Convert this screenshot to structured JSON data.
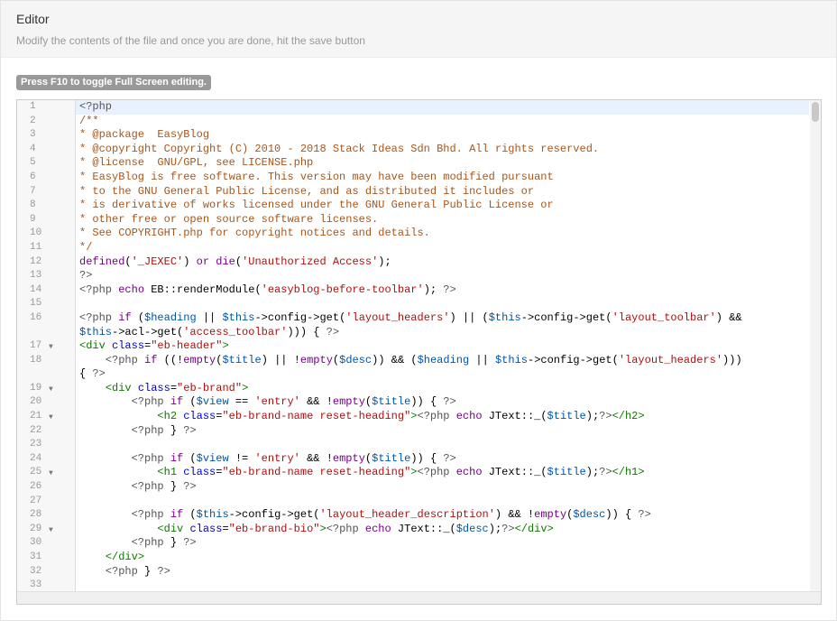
{
  "panel": {
    "title": "Editor",
    "description": "Modify the contents of the file and once you are done, hit the save button"
  },
  "badge": {
    "label": "Press F10 to toggle Full Screen editing."
  },
  "editor": {
    "active_line": 1,
    "lines": [
      {
        "n": "1",
        "fold": false,
        "tokens": [
          [
            "meta",
            "<?php"
          ]
        ]
      },
      {
        "n": "2",
        "fold": false,
        "tokens": [
          [
            "comment",
            "/**"
          ]
        ]
      },
      {
        "n": "3",
        "fold": false,
        "tokens": [
          [
            "comment",
            "* @package  EasyBlog"
          ]
        ]
      },
      {
        "n": "4",
        "fold": false,
        "tokens": [
          [
            "comment",
            "* @copyright Copyright (C) 2010 - 2018 Stack Ideas Sdn Bhd. All rights reserved."
          ]
        ]
      },
      {
        "n": "5",
        "fold": false,
        "tokens": [
          [
            "comment",
            "* @license  GNU/GPL, see LICENSE.php"
          ]
        ]
      },
      {
        "n": "6",
        "fold": false,
        "tokens": [
          [
            "comment",
            "* EasyBlog is free software. This version may have been modified pursuant"
          ]
        ]
      },
      {
        "n": "7",
        "fold": false,
        "tokens": [
          [
            "comment",
            "* to the GNU General Public License, and as distributed it includes or"
          ]
        ]
      },
      {
        "n": "8",
        "fold": false,
        "tokens": [
          [
            "comment",
            "* is derivative of works licensed under the GNU General Public License or"
          ]
        ]
      },
      {
        "n": "9",
        "fold": false,
        "tokens": [
          [
            "comment",
            "* other free or open source software licenses."
          ]
        ]
      },
      {
        "n": "10",
        "fold": false,
        "tokens": [
          [
            "comment",
            "* See COPYRIGHT.php for copyright notices and details."
          ]
        ]
      },
      {
        "n": "11",
        "fold": false,
        "tokens": [
          [
            "comment",
            "*/"
          ]
        ]
      },
      {
        "n": "12",
        "fold": false,
        "tokens": [
          [
            "keyword",
            "defined"
          ],
          [
            "plain",
            "("
          ],
          [
            "string",
            "'_JEXEC'"
          ],
          [
            "plain",
            ") "
          ],
          [
            "keyword",
            "or"
          ],
          [
            "plain",
            " "
          ],
          [
            "keyword",
            "die"
          ],
          [
            "plain",
            "("
          ],
          [
            "string",
            "'Unauthorized Access'"
          ],
          [
            "plain",
            ");"
          ]
        ]
      },
      {
        "n": "13",
        "fold": false,
        "tokens": [
          [
            "meta",
            "?>"
          ]
        ]
      },
      {
        "n": "14",
        "fold": false,
        "tokens": [
          [
            "meta",
            "<?php"
          ],
          [
            "plain",
            " "
          ],
          [
            "keyword",
            "echo"
          ],
          [
            "plain",
            " EB::renderModule("
          ],
          [
            "string",
            "'easyblog-before-toolbar'"
          ],
          [
            "plain",
            "); "
          ],
          [
            "meta",
            "?>"
          ]
        ]
      },
      {
        "n": "15",
        "fold": false,
        "tokens": []
      },
      {
        "n": "16",
        "fold": false,
        "tokens": [
          [
            "meta",
            "<?php"
          ],
          [
            "plain",
            " "
          ],
          [
            "keyword",
            "if"
          ],
          [
            "plain",
            " ("
          ],
          [
            "variable",
            "$heading"
          ],
          [
            "plain",
            " || "
          ],
          [
            "variable",
            "$this"
          ],
          [
            "plain",
            "->config->get("
          ],
          [
            "string",
            "'layout_headers'"
          ],
          [
            "plain",
            ") || ("
          ],
          [
            "variable",
            "$this"
          ],
          [
            "plain",
            "->config->get("
          ],
          [
            "string",
            "'layout_toolbar'"
          ],
          [
            "plain",
            ") &&"
          ]
        ]
      },
      {
        "n": "",
        "fold": false,
        "tokens": [
          [
            "variable",
            "$this"
          ],
          [
            "plain",
            "->acl->get("
          ],
          [
            "string",
            "'access_toolbar'"
          ],
          [
            "plain",
            "))) { "
          ],
          [
            "meta",
            "?>"
          ]
        ]
      },
      {
        "n": "17",
        "fold": true,
        "tokens": [
          [
            "tag",
            "<div"
          ],
          [
            "plain",
            " "
          ],
          [
            "attr",
            "class"
          ],
          [
            "plain",
            "="
          ],
          [
            "attrval",
            "\"eb-header\""
          ],
          [
            "tag",
            ">"
          ]
        ]
      },
      {
        "n": "18",
        "fold": false,
        "tokens": [
          [
            "plain",
            "    "
          ],
          [
            "meta",
            "<?php"
          ],
          [
            "plain",
            " "
          ],
          [
            "keyword",
            "if"
          ],
          [
            "plain",
            " ((!"
          ],
          [
            "keyword",
            "empty"
          ],
          [
            "plain",
            "("
          ],
          [
            "variable",
            "$title"
          ],
          [
            "plain",
            ") || !"
          ],
          [
            "keyword",
            "empty"
          ],
          [
            "plain",
            "("
          ],
          [
            "variable",
            "$desc"
          ],
          [
            "plain",
            ")) && ("
          ],
          [
            "variable",
            "$heading"
          ],
          [
            "plain",
            " || "
          ],
          [
            "variable",
            "$this"
          ],
          [
            "plain",
            "->config->get("
          ],
          [
            "string",
            "'layout_headers'"
          ],
          [
            "plain",
            ")))"
          ]
        ]
      },
      {
        "n": "",
        "fold": false,
        "tokens": [
          [
            "plain",
            "{ "
          ],
          [
            "meta",
            "?>"
          ]
        ]
      },
      {
        "n": "19",
        "fold": true,
        "tokens": [
          [
            "plain",
            "    "
          ],
          [
            "tag",
            "<div"
          ],
          [
            "plain",
            " "
          ],
          [
            "attr",
            "class"
          ],
          [
            "plain",
            "="
          ],
          [
            "attrval",
            "\"eb-brand\""
          ],
          [
            "tag",
            ">"
          ]
        ]
      },
      {
        "n": "20",
        "fold": false,
        "tokens": [
          [
            "plain",
            "        "
          ],
          [
            "meta",
            "<?php"
          ],
          [
            "plain",
            " "
          ],
          [
            "keyword",
            "if"
          ],
          [
            "plain",
            " ("
          ],
          [
            "variable",
            "$view"
          ],
          [
            "plain",
            " == "
          ],
          [
            "string",
            "'entry'"
          ],
          [
            "plain",
            " && !"
          ],
          [
            "keyword",
            "empty"
          ],
          [
            "plain",
            "("
          ],
          [
            "variable",
            "$title"
          ],
          [
            "plain",
            ")) { "
          ],
          [
            "meta",
            "?>"
          ]
        ]
      },
      {
        "n": "21",
        "fold": true,
        "tokens": [
          [
            "plain",
            "            "
          ],
          [
            "tag",
            "<h2"
          ],
          [
            "plain",
            " "
          ],
          [
            "attr",
            "class"
          ],
          [
            "plain",
            "="
          ],
          [
            "attrval",
            "\"eb-brand-name reset-heading\""
          ],
          [
            "tag",
            ">"
          ],
          [
            "meta",
            "<?php"
          ],
          [
            "plain",
            " "
          ],
          [
            "keyword",
            "echo"
          ],
          [
            "plain",
            " JText::_("
          ],
          [
            "variable",
            "$title"
          ],
          [
            "plain",
            ");"
          ],
          [
            "meta",
            "?>"
          ],
          [
            "tag",
            "</h2>"
          ]
        ]
      },
      {
        "n": "22",
        "fold": false,
        "tokens": [
          [
            "plain",
            "        "
          ],
          [
            "meta",
            "<?php"
          ],
          [
            "plain",
            " } "
          ],
          [
            "meta",
            "?>"
          ]
        ]
      },
      {
        "n": "23",
        "fold": false,
        "tokens": []
      },
      {
        "n": "24",
        "fold": false,
        "tokens": [
          [
            "plain",
            "        "
          ],
          [
            "meta",
            "<?php"
          ],
          [
            "plain",
            " "
          ],
          [
            "keyword",
            "if"
          ],
          [
            "plain",
            " ("
          ],
          [
            "variable",
            "$view"
          ],
          [
            "plain",
            " != "
          ],
          [
            "string",
            "'entry'"
          ],
          [
            "plain",
            " && !"
          ],
          [
            "keyword",
            "empty"
          ],
          [
            "plain",
            "("
          ],
          [
            "variable",
            "$title"
          ],
          [
            "plain",
            ")) { "
          ],
          [
            "meta",
            "?>"
          ]
        ]
      },
      {
        "n": "25",
        "fold": true,
        "tokens": [
          [
            "plain",
            "            "
          ],
          [
            "tag",
            "<h1"
          ],
          [
            "plain",
            " "
          ],
          [
            "attr",
            "class"
          ],
          [
            "plain",
            "="
          ],
          [
            "attrval",
            "\"eb-brand-name reset-heading\""
          ],
          [
            "tag",
            ">"
          ],
          [
            "meta",
            "<?php"
          ],
          [
            "plain",
            " "
          ],
          [
            "keyword",
            "echo"
          ],
          [
            "plain",
            " JText::_("
          ],
          [
            "variable",
            "$title"
          ],
          [
            "plain",
            ");"
          ],
          [
            "meta",
            "?>"
          ],
          [
            "tag",
            "</h1>"
          ]
        ]
      },
      {
        "n": "26",
        "fold": false,
        "tokens": [
          [
            "plain",
            "        "
          ],
          [
            "meta",
            "<?php"
          ],
          [
            "plain",
            " } "
          ],
          [
            "meta",
            "?>"
          ]
        ]
      },
      {
        "n": "27",
        "fold": false,
        "tokens": []
      },
      {
        "n": "28",
        "fold": false,
        "tokens": [
          [
            "plain",
            "        "
          ],
          [
            "meta",
            "<?php"
          ],
          [
            "plain",
            " "
          ],
          [
            "keyword",
            "if"
          ],
          [
            "plain",
            " ("
          ],
          [
            "variable",
            "$this"
          ],
          [
            "plain",
            "->config->get("
          ],
          [
            "string",
            "'layout_header_description'"
          ],
          [
            "plain",
            ") && !"
          ],
          [
            "keyword",
            "empty"
          ],
          [
            "plain",
            "("
          ],
          [
            "variable",
            "$desc"
          ],
          [
            "plain",
            ")) { "
          ],
          [
            "meta",
            "?>"
          ]
        ]
      },
      {
        "n": "29",
        "fold": true,
        "tokens": [
          [
            "plain",
            "            "
          ],
          [
            "tag",
            "<div"
          ],
          [
            "plain",
            " "
          ],
          [
            "attr",
            "class"
          ],
          [
            "plain",
            "="
          ],
          [
            "attrval",
            "\"eb-brand-bio\""
          ],
          [
            "tag",
            ">"
          ],
          [
            "meta",
            "<?php"
          ],
          [
            "plain",
            " "
          ],
          [
            "keyword",
            "echo"
          ],
          [
            "plain",
            " JText::_("
          ],
          [
            "variable",
            "$desc"
          ],
          [
            "plain",
            ");"
          ],
          [
            "meta",
            "?>"
          ],
          [
            "tag",
            "</div>"
          ]
        ]
      },
      {
        "n": "30",
        "fold": false,
        "tokens": [
          [
            "plain",
            "        "
          ],
          [
            "meta",
            "<?php"
          ],
          [
            "plain",
            " } "
          ],
          [
            "meta",
            "?>"
          ]
        ]
      },
      {
        "n": "31",
        "fold": false,
        "tokens": [
          [
            "plain",
            "    "
          ],
          [
            "tag",
            "</div>"
          ]
        ]
      },
      {
        "n": "32",
        "fold": false,
        "tokens": [
          [
            "plain",
            "    "
          ],
          [
            "meta",
            "<?php"
          ],
          [
            "plain",
            " } "
          ],
          [
            "meta",
            "?>"
          ]
        ]
      },
      {
        "n": "33",
        "fold": false,
        "tokens": []
      }
    ]
  }
}
